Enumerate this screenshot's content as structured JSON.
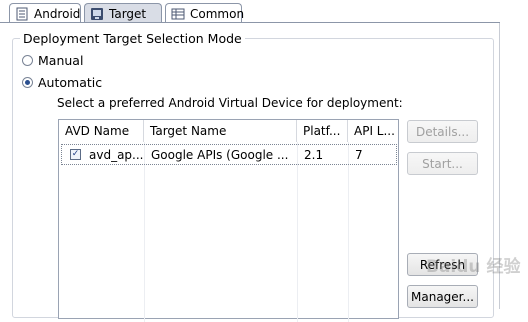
{
  "tabs": [
    {
      "label": "Android",
      "icon": "android-tab-icon",
      "active": false
    },
    {
      "label": "Target",
      "icon": "target-tab-icon",
      "active": true
    },
    {
      "label": "Common",
      "icon": "common-tab-icon",
      "active": false
    }
  ],
  "group_title": "Deployment Target Selection Mode",
  "mode": {
    "manual_label": "Manual",
    "automatic_label": "Automatic",
    "selected": "Automatic"
  },
  "avd_prompt": "Select a preferred Android Virtual Device for deployment:",
  "table": {
    "columns": [
      "AVD Name",
      "Target Name",
      "Platf...",
      "API L..."
    ],
    "rows": [
      {
        "checked": true,
        "avd_name": "avd_ap...",
        "target_name": "Google APIs (Google ...",
        "platform": "2.1",
        "api_level": "7"
      }
    ]
  },
  "buttons": {
    "details": "Details...",
    "start": "Start...",
    "refresh": "Refresh",
    "manager": "Manager..."
  },
  "watermark": "Baidu 经验",
  "colors": {
    "tab_border": "#8c96a8",
    "active_tab": "#d9dde6",
    "radio_dot": "#2a4f8f"
  }
}
